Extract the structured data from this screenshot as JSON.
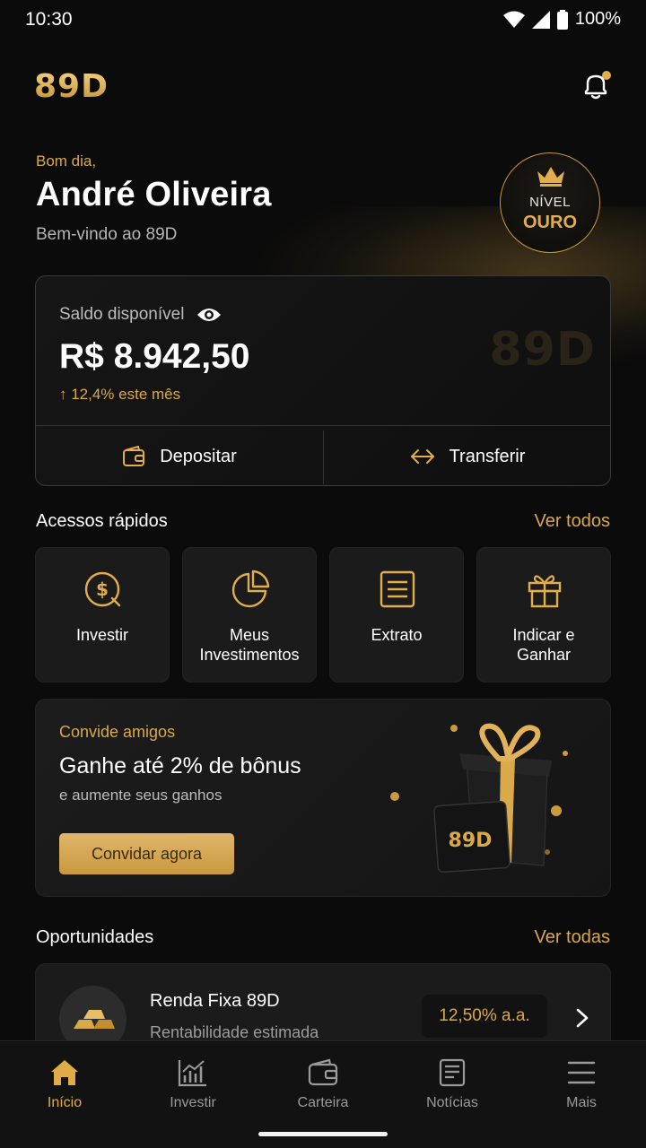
{
  "status_bar": {
    "time": "10:30",
    "battery": "100%"
  },
  "header": {
    "logo": "89D",
    "notification_icon": "bell-icon",
    "notification_dot_color": "#e1ad4d"
  },
  "greeting": {
    "salutation": "Bom dia,",
    "name": "André Oliveira",
    "subtitle": "Bem-vindo ao 89D"
  },
  "level_badge": {
    "label": "NÍVEL",
    "value": "OURO",
    "icon": "crown-icon"
  },
  "balance": {
    "label": "Saldo disponível",
    "amount": "R$ 8.942,50",
    "change": "↑ 12,4% este mês",
    "watermark": "89D",
    "actions": [
      {
        "label": "Depositar",
        "icon": "wallet-icon"
      },
      {
        "label": "Transferir",
        "icon": "transfer-arrows-icon"
      }
    ]
  },
  "quick_access": {
    "title": "Acessos rápidos",
    "link": "Ver todos",
    "items": [
      {
        "label": "Investir",
        "icon": "dollar-coin-icon"
      },
      {
        "label": "Meus\nInvestimentos",
        "icon": "pie-chart-icon"
      },
      {
        "label": "Extrato",
        "icon": "document-list-icon"
      },
      {
        "label": "Indicar e\nGanhar",
        "icon": "gift-icon"
      }
    ]
  },
  "invite": {
    "kicker": "Convide amigos",
    "headline": "Ganhe até 2% de bônus",
    "subtext": "e aumente seus ganhos",
    "button": "Convidar agora",
    "image_label": "89D"
  },
  "opportunities": {
    "title": "Oportunidades",
    "link": "Ver todas",
    "items": [
      {
        "title": "Renda Fixa 89D",
        "subtitle": "Rentabilidade estimada",
        "rate": "12,50% a.a.",
        "icon": "gold-bars-icon"
      }
    ]
  },
  "bottom_nav": [
    {
      "label": "Início",
      "icon": "home-icon",
      "active": true
    },
    {
      "label": "Investir",
      "icon": "chart-icon",
      "active": false
    },
    {
      "label": "Carteira",
      "icon": "wallet-icon",
      "active": false
    },
    {
      "label": "Notícias",
      "icon": "news-icon",
      "active": false
    },
    {
      "label": "Mais",
      "icon": "menu-icon",
      "active": false
    }
  ]
}
